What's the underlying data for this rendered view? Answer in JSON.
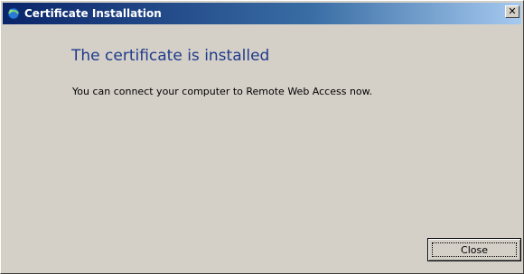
{
  "window": {
    "title": "Certificate Installation",
    "close_glyph": "✕",
    "icon": "certificate-icon"
  },
  "content": {
    "heading": "The certificate is installed",
    "message": "You can connect your computer to Remote Web Access now."
  },
  "buttons": {
    "close_label": "Close"
  },
  "colors": {
    "heading": "#1f3a8a",
    "titlebar_start": "#0a246a",
    "titlebar_end": "#a6caf0",
    "background": "#d4d0c8"
  }
}
